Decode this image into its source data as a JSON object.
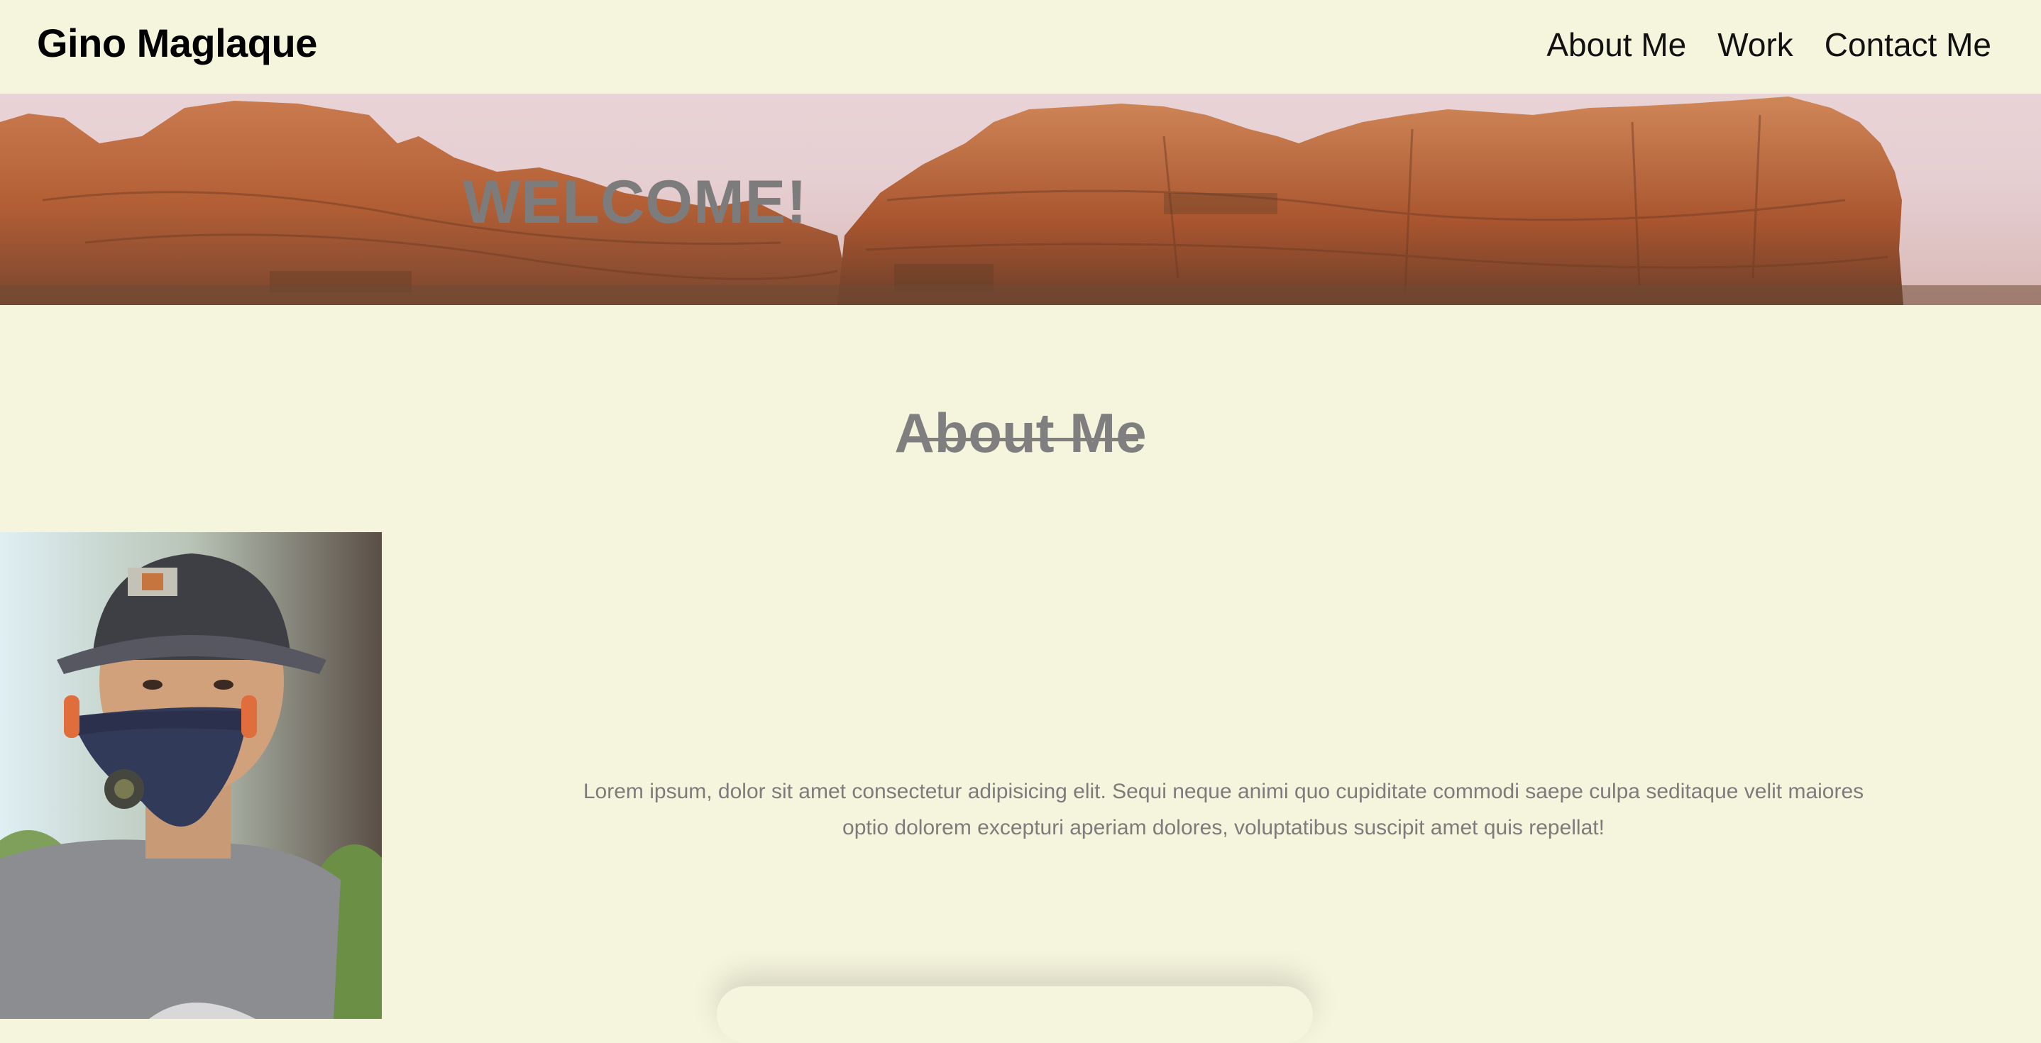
{
  "header": {
    "site_title": "Gino Maglaque",
    "nav": [
      {
        "label": "About Me"
      },
      {
        "label": "Work"
      },
      {
        "label": "Contact Me"
      }
    ]
  },
  "hero": {
    "heading": "WELCOME!"
  },
  "about": {
    "heading": "About Me",
    "body": "Lorem ipsum, dolor sit amet consectetur adipisicing elit. Sequi neque animi quo cupiditate commodi saepe culpa seditaque velit maiores optio dolorem excepturi aperiam dolores, voluptatibus suscipit amet quis repellat!"
  },
  "colors": {
    "background": "#f5f4dc",
    "heading_gray": "#7f7f7f",
    "rock": "#b8643a"
  }
}
